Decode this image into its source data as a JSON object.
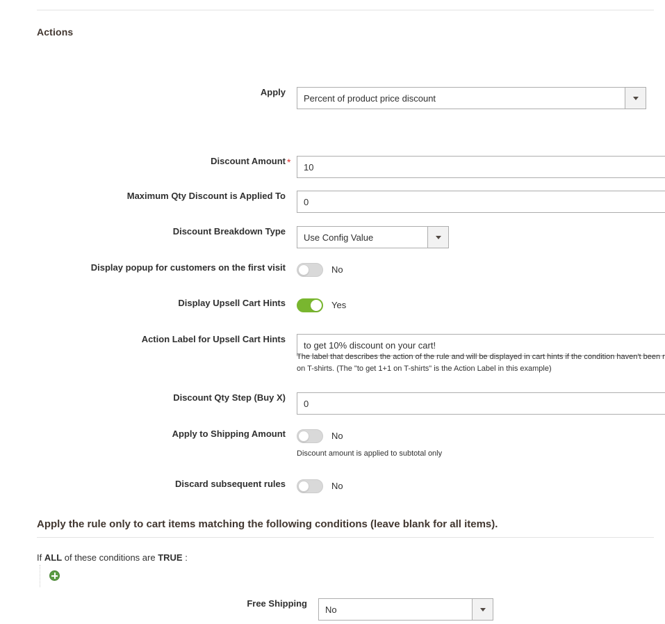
{
  "section": {
    "title": "Actions"
  },
  "fields": {
    "apply": {
      "label": "Apply",
      "value": "Percent of product price discount"
    },
    "discount_amount": {
      "label": "Discount Amount",
      "required_marker": "*",
      "value": "10"
    },
    "max_qty": {
      "label": "Maximum Qty Discount is Applied To",
      "value": "0"
    },
    "breakdown_type": {
      "label": "Discount Breakdown Type",
      "value": "Use Config Value"
    },
    "popup_first_visit": {
      "label": "Display popup for customers on the first visit",
      "state": "No"
    },
    "upsell_hints": {
      "label": "Display Upsell Cart Hints",
      "state": "Yes"
    },
    "action_label": {
      "label": "Action Label for Upsell Cart Hints",
      "value": "to get 10% discount on your cart!",
      "note_line1": "The label that describes the action of the rule and will be displayed in cart hints if the condition haven't been reach",
      "note_line2": "on T-shirts. (The \"to get 1+1 on T-shirts\" is the Action Label in this example)"
    },
    "qty_step": {
      "label": "Discount Qty Step (Buy X)",
      "value": "0"
    },
    "apply_shipping": {
      "label": "Apply to Shipping Amount",
      "state": "No",
      "note": "Discount amount is applied to subtotal only"
    },
    "discard_subsequent": {
      "label": "Discard subsequent rules",
      "state": "No"
    }
  },
  "conditions": {
    "heading": "Apply the rule only to cart items matching the following conditions (leave blank for all items).",
    "sentence_if": "If",
    "sentence_aggregator": "ALL",
    "sentence_mid": "of these conditions are",
    "sentence_value": "TRUE",
    "sentence_colon": ":",
    "add_icon": "plus-circle-icon",
    "free_shipping": {
      "label": "Free Shipping",
      "value": "No"
    }
  },
  "colors": {
    "toggle_on": "#79b62f",
    "toggle_off": "#d9d9d9",
    "required_star": "#e02b27",
    "add_button": "#5b9c44",
    "heading_text": "#41362f",
    "body_text": "#303030",
    "border": "#adadad",
    "rule": "#e3e3e3"
  }
}
